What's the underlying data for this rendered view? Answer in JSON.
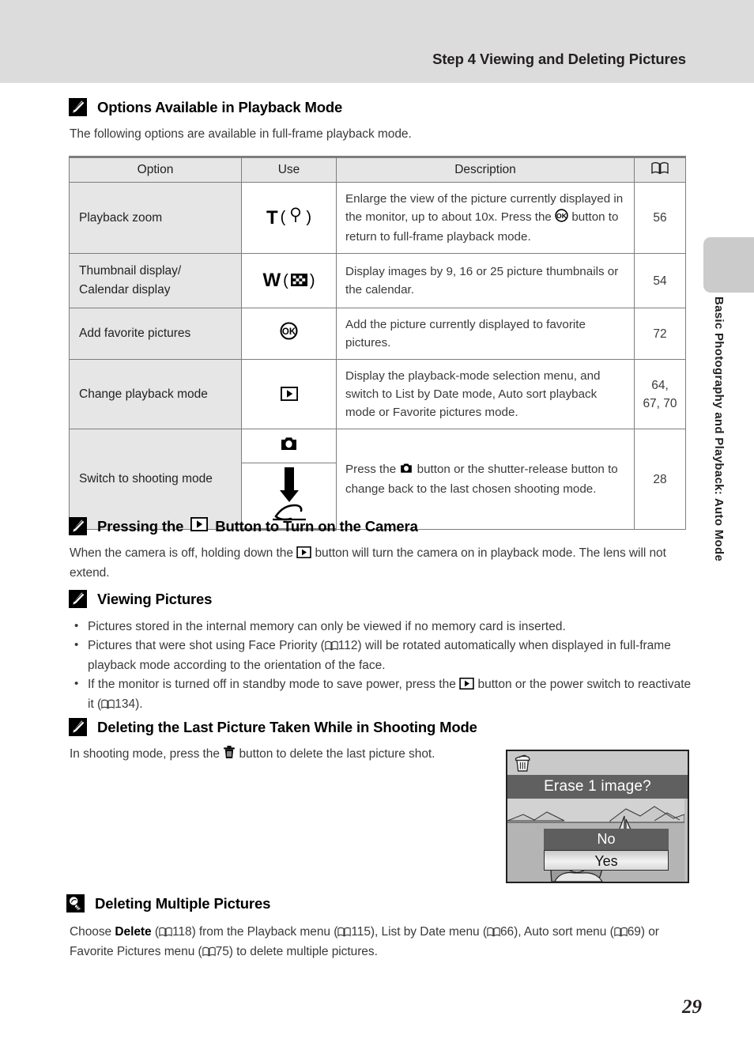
{
  "header": {
    "title": "Step 4 Viewing and Deleting Pictures"
  },
  "side_tab": {
    "vertical_label": "Basic Photography and Playback: Auto Mode"
  },
  "sections": {
    "options_playback": {
      "icon": "note-pencil-icon",
      "heading": "Options Available in Playback Mode",
      "intro": "The following options are available in full-frame playback mode."
    },
    "pressing_button": {
      "icon": "note-pencil-icon",
      "heading_before": "Pressing the",
      "heading_icon": "playback-button-icon",
      "heading_after": "Button to Turn on the Camera",
      "body_1": "When the camera is off, holding down the",
      "body_2": "button will turn the camera on in playback mode. The lens will not extend."
    },
    "viewing_pictures": {
      "icon": "note-pencil-icon",
      "heading": "Viewing Pictures",
      "bullets": [
        {
          "text": "Pictures stored in the internal memory can only be viewed if no memory card is inserted."
        },
        {
          "text_1": "Pictures that were shot using Face Priority (",
          "ref": "112",
          "text_2": ") will be rotated automatically when displayed in full-frame playback mode according to the orientation of the face."
        },
        {
          "text_1": "If the monitor is turned off in standby mode to save power, press the",
          "icon": "playback-button-icon",
          "text_2": "button or the power switch to reactivate it (",
          "ref": "134",
          "text_3": ")."
        }
      ]
    },
    "deleting_last": {
      "icon": "note-pencil-icon",
      "heading": "Deleting the Last Picture Taken While in Shooting Mode",
      "body_1": "In shooting mode, press the",
      "body_icon": "trash-can-icon",
      "body_2": "button to delete the last picture shot."
    },
    "deleting_multiple": {
      "icon": "tip-lightbulb-icon",
      "heading": "Deleting Multiple Pictures",
      "body_1": "Choose ",
      "bold_1": "Delete",
      "body_2": " (",
      "ref_1": "118",
      "body_3": ") from the Playback menu (",
      "ref_2": "115",
      "body_4": "), List by Date menu (",
      "ref_3": "66",
      "body_5": "), Auto sort menu (",
      "ref_4": "69",
      "body_6": ") or Favorite Pictures menu (",
      "ref_5": "75",
      "body_7": ") to delete multiple pictures."
    }
  },
  "table": {
    "headers": {
      "option": "Option",
      "use": "Use",
      "description": "Description",
      "page": "book-icon"
    },
    "rows": [
      {
        "option": "Playback zoom",
        "use_letter": "T",
        "use_icon": "magnifier-icon",
        "desc_1": "Enlarge the view of the picture currently displayed in the monitor, up to about 10x. Press the",
        "desc_icon": "ok-button-icon",
        "desc_2": "button to return to full-frame playback mode.",
        "page": "56"
      },
      {
        "option": "Thumbnail display/ Calendar display",
        "use_letter": "W",
        "use_icon": "thumbnail-grid-icon",
        "desc_1": "Display images by 9, 16 or 25 picture thumbnails or the calendar.",
        "page": "54"
      },
      {
        "option": "Add favorite pictures",
        "use_icon": "ok-button-icon",
        "desc_1": "Add the picture currently displayed to favorite pictures.",
        "page": "72"
      },
      {
        "option": "Change playback mode",
        "use_icon": "playback-button-icon",
        "desc_1": "Display the playback-mode selection menu, and switch to List by Date mode, Auto sort playback mode or Favorite pictures mode.",
        "page_line1": "64,",
        "page_line2": "67, 70"
      },
      {
        "option": "Switch to shooting mode",
        "use_icon_1": "camera-body-icon",
        "use_icon_2": "shutter-press-arrow-icon",
        "desc_1": "Press the",
        "desc_icon": "camera-body-icon",
        "desc_2": "button or the shutter-release button to change back to the last chosen shooting mode.",
        "page": "28"
      }
    ]
  },
  "monitor": {
    "trash_icon": "trash-can-icon",
    "banner": "Erase 1 image?",
    "option_no": "No",
    "option_yes": "Yes"
  },
  "page_number": "29"
}
